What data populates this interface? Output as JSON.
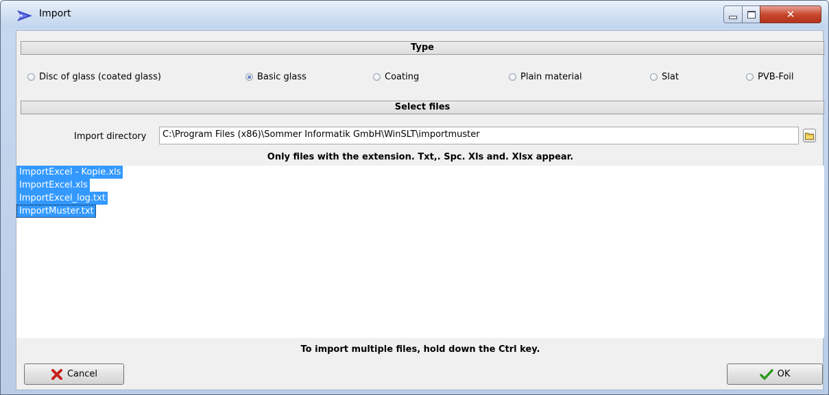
{
  "window": {
    "title": "Import"
  },
  "type_section": {
    "header": "Type",
    "options": [
      {
        "label": "Disc of glass (coated glass)",
        "checked": false
      },
      {
        "label": "Basic glass",
        "checked": true
      },
      {
        "label": "Coating",
        "checked": false
      },
      {
        "label": "Plain material",
        "checked": false
      },
      {
        "label": "Slat",
        "checked": false
      },
      {
        "label": "PVB-Foil",
        "checked": false
      }
    ]
  },
  "files_section": {
    "header": "Select files",
    "directory_label": "Import directory",
    "directory_value": "C:\\Program Files (x86)\\Sommer Informatik GmbH\\WinSLT\\importmuster",
    "extension_note": "Only files with the extension. Txt,. Spc. Xls and. Xlsx appear.",
    "files": [
      "ImportExcel - Kopie.xls",
      "ImportExcel.xls",
      "ImportExcel_log.txt",
      "ImportMuster.txt"
    ],
    "multi_select_note": "To import multiple files, hold down the Ctrl key."
  },
  "buttons": {
    "cancel": "Cancel",
    "ok": "OK"
  },
  "icons": {
    "app": "app-arrow-icon",
    "folder": "folder-icon",
    "cancel": "red-x-icon",
    "ok": "green-check-icon"
  },
  "colors": {
    "selection": "#3399ff",
    "close_button": "#c8492f"
  }
}
